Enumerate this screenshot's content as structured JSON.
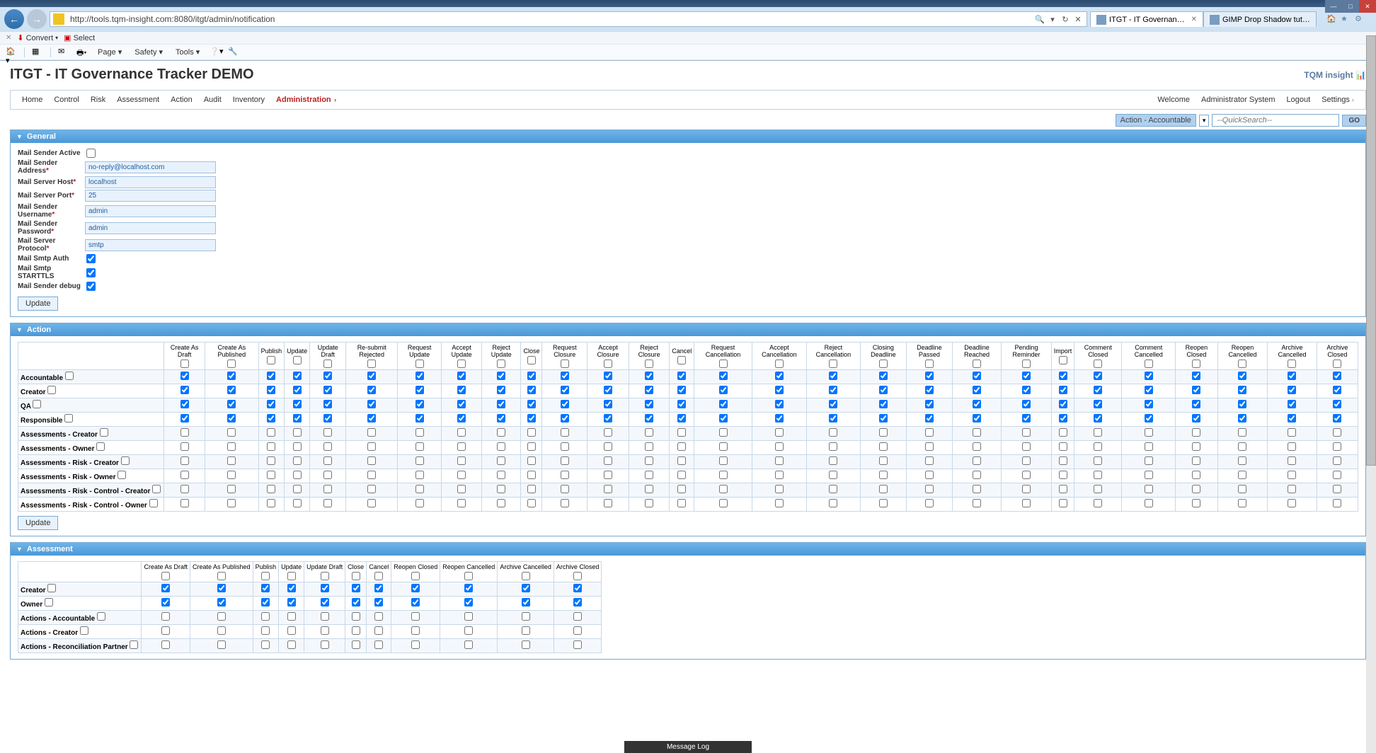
{
  "browser": {
    "url": "http://tools.tqm-insight.com:8080/itgt/admin/notification",
    "tab1": "ITGT - IT Governance Track...",
    "tab2": "GIMP Drop Shadow tutorial - T...",
    "convert": "Convert",
    "select": "Select",
    "page": "Page",
    "safety": "Safety",
    "tools": "Tools"
  },
  "app": {
    "title": "ITGT - IT Governance Tracker DEMO",
    "logo": "TQM insight",
    "nav": {
      "home": "Home",
      "control": "Control",
      "risk": "Risk",
      "assessment": "Assessment",
      "action": "Action",
      "audit": "Audit",
      "inventory": "Inventory",
      "administration": "Administration"
    },
    "welcome": "Welcome",
    "adminSystem": "Administrator System",
    "logout": "Logout",
    "settings": "Settings"
  },
  "quicksearch": {
    "label": "Action - Accountable",
    "placeholder": "--QuickSearch--",
    "go": "GO"
  },
  "general": {
    "header": "General",
    "mailSenderActive": "Mail Sender Active",
    "mailSenderAddress": "Mail Sender Address",
    "mailServerHost": "Mail Server Host",
    "mailServerPort": "Mail Server Port",
    "mailSenderUsername": "Mail Sender Username",
    "mailSenderPassword": "Mail Sender Password",
    "mailServerProtocol": "Mail Server Protocol",
    "mailSmtpAuth": "Mail Smtp Auth",
    "mailSmtpStarttls": "Mail Smtp STARTTLS",
    "mailSenderDebug": "Mail Sender debug",
    "vals": {
      "address": "no-reply@localhost.com",
      "host": "localhost",
      "port": "25",
      "username": "admin",
      "password": "admin",
      "protocol": "smtp"
    },
    "update": "Update"
  },
  "action": {
    "header": "Action",
    "cols": [
      "Create As Draft",
      "Create As Published",
      "Publish",
      "Update",
      "Update Draft",
      "Re-submit Rejected",
      "Request Update",
      "Accept Update",
      "Reject Update",
      "Close",
      "Request Closure",
      "Accept Closure",
      "Reject Closure",
      "Cancel",
      "Request Cancellation",
      "Accept Cancellation",
      "Reject Cancellation",
      "Closing Deadline",
      "Deadline Passed",
      "Deadline Reached",
      "Pending Reminder",
      "Import",
      "Comment Closed",
      "Comment Cancelled",
      "Reopen Closed",
      "Reopen Cancelled",
      "Archive Cancelled",
      "Archive Closed"
    ],
    "rows": [
      {
        "label": "Accountable",
        "checked": true
      },
      {
        "label": "Creator",
        "checked": true
      },
      {
        "label": "QA",
        "checked": true
      },
      {
        "label": "Responsible",
        "checked": true
      },
      {
        "label": "Assessments - Creator",
        "checked": false
      },
      {
        "label": "Assessments - Owner",
        "checked": false
      },
      {
        "label": "Assessments - Risk - Creator",
        "checked": false
      },
      {
        "label": "Assessments - Risk - Owner",
        "checked": false
      },
      {
        "label": "Assessments - Risk - Control - Creator",
        "checked": false
      },
      {
        "label": "Assessments - Risk - Control - Owner",
        "checked": false
      }
    ],
    "update": "Update"
  },
  "assessment": {
    "header": "Assessment",
    "cols": [
      "Create As Draft",
      "Create As Published",
      "Publish",
      "Update",
      "Update Draft",
      "Close",
      "Cancel",
      "Reopen Closed",
      "Reopen Cancelled",
      "Archive Cancelled",
      "Archive Closed"
    ],
    "rows": [
      {
        "label": "Creator",
        "checked": true
      },
      {
        "label": "Owner",
        "checked": true
      },
      {
        "label": "Actions - Accountable",
        "checked": false
      },
      {
        "label": "Actions - Creator",
        "checked": false
      },
      {
        "label": "Actions - Reconciliation Partner",
        "checked": false
      }
    ]
  },
  "messageLog": "Message Log"
}
